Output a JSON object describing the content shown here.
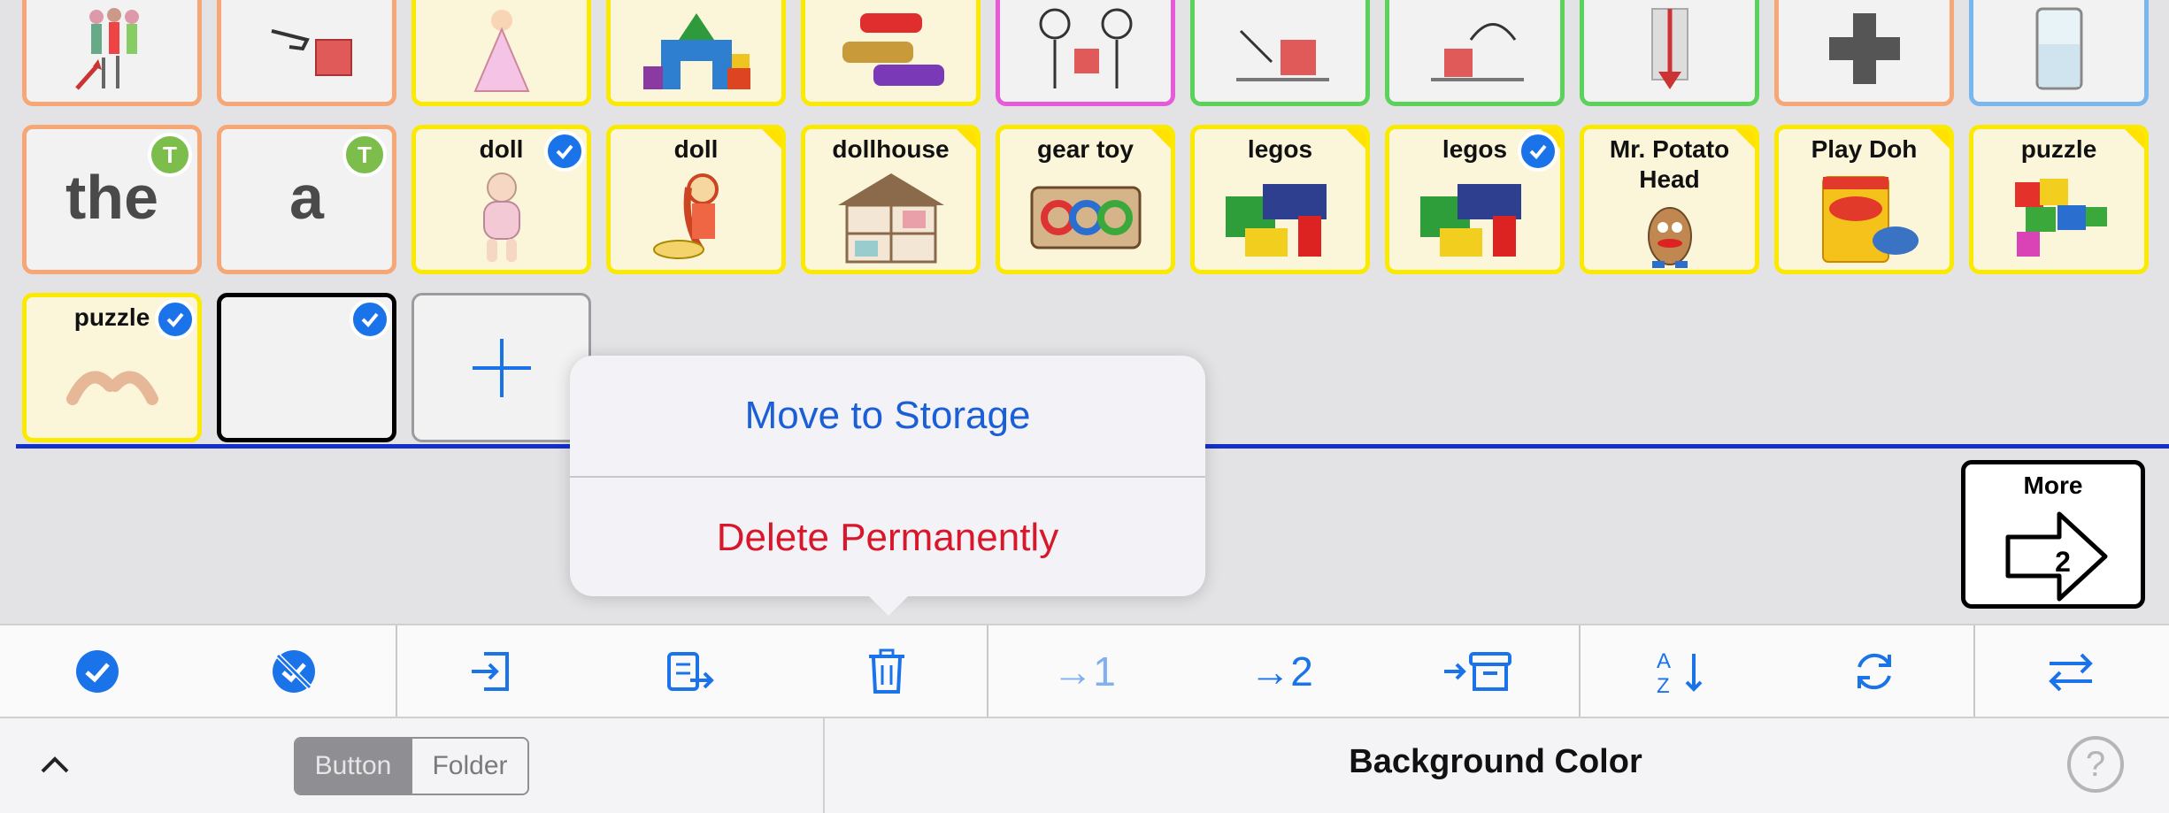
{
  "grid": {
    "row2": [
      {
        "label": "the"
      },
      {
        "label": "a"
      },
      {
        "label": "doll"
      },
      {
        "label": "doll"
      },
      {
        "label": "dollhouse"
      },
      {
        "label": "gear toy"
      },
      {
        "label": "legos"
      },
      {
        "label": "legos"
      },
      {
        "label": "Mr. Potato Head"
      },
      {
        "label": "Play Doh"
      },
      {
        "label": "puzzle"
      }
    ],
    "row3": [
      {
        "label": "puzzle"
      }
    ],
    "badge_letter": "T",
    "more": {
      "label": "More",
      "page": "2"
    }
  },
  "popup": {
    "move": "Move to Storage",
    "delete": "Delete Permanently"
  },
  "toolbar": {
    "to_page_1": "→1",
    "to_page_2": "→2"
  },
  "bottom": {
    "segment": [
      "Button",
      "Folder"
    ],
    "segment_selected": "Button",
    "title": "Background Color",
    "help": "?"
  },
  "colors": {
    "accent": "#1a73e8",
    "delete": "#d8172b",
    "divider_line": "#1330c9",
    "yellow_border": "#fbe900",
    "orange_border": "#f6a775",
    "green_border": "#5bd35b",
    "pink_border": "#e75ad9",
    "blue_border": "#7ab7ef"
  }
}
